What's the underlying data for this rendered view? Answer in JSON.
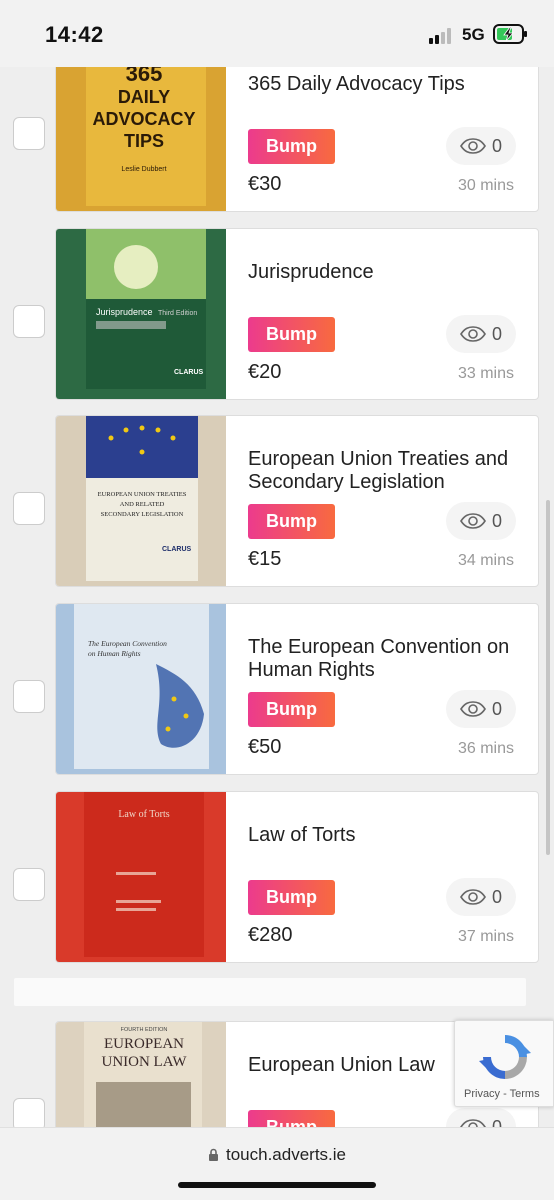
{
  "status_bar": {
    "time": "14:42",
    "network": "5G"
  },
  "bump_label": "Bump",
  "listings": [
    {
      "title": "365 Daily Advocacy Tips",
      "price": "€30",
      "views": "0",
      "age": "30 mins",
      "cover": {
        "color": "#d9a332",
        "text1": "365",
        "text2": "DAILY",
        "text3": "ADVOCACY",
        "text4": "TIPS",
        "author": "Leslie Dubbert"
      }
    },
    {
      "title": "Jurisprudence",
      "price": "€20",
      "views": "0",
      "age": "33 mins",
      "cover": {
        "color": "#2d6a44",
        "text1": "Jurisprudence",
        "text2": "Third Edition",
        "text3": "CLARUS"
      }
    },
    {
      "title": "European Union Treaties and Secondary Legislation",
      "price": "€15",
      "views": "0",
      "age": "34 mins",
      "cover": {
        "color": "#efece0",
        "text1": "EUROPEAN UNION TREATIES",
        "text2": "AND RELATED",
        "text3": "SECONDARY LEGISLATION",
        "text4": "CLARUS"
      }
    },
    {
      "title": "The European Convention on Human Rights",
      "price": "€50",
      "views": "0",
      "age": "36 mins",
      "cover": {
        "color": "#c6d8ea",
        "text1": "The European Convention",
        "text2": "on Human Rights"
      }
    },
    {
      "title": "Law of Torts",
      "price": "€280",
      "views": "0",
      "age": "37 mins",
      "cover": {
        "color": "#cc2a1c",
        "text1": "Law of Torts"
      }
    },
    {
      "title": "European Union Law",
      "price": "",
      "views": "0",
      "age": "",
      "cover": {
        "color": "#ddd2bf",
        "text1": "EUROPEAN",
        "text2": "UNION LAW",
        "text3": "FOURTH EDITION"
      }
    }
  ],
  "recaptcha": {
    "links": "Privacy - Terms"
  },
  "url_bar": {
    "url": "touch.adverts.ie"
  },
  "colors": {
    "bump_start": "#ec3b8d",
    "bump_end": "#f86a3f"
  }
}
